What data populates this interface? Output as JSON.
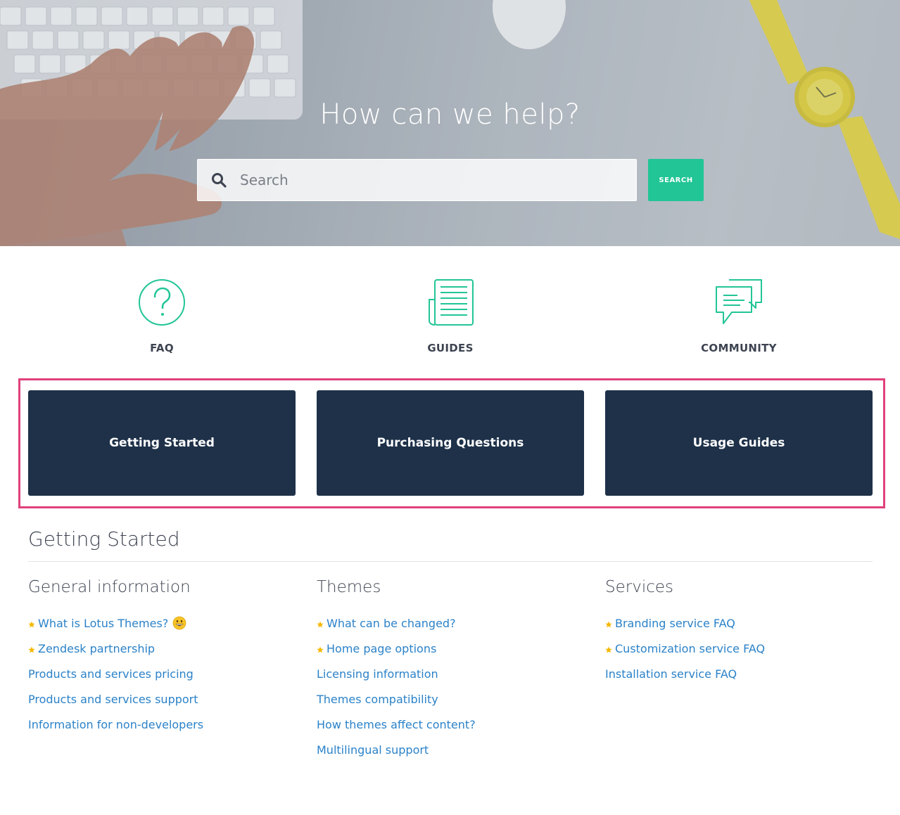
{
  "hero": {
    "title": "How can we help?",
    "search_placeholder": "Search",
    "search_button_label": "SEARCH"
  },
  "icon_nav": [
    {
      "label": "FAQ",
      "icon": "question-circle-icon"
    },
    {
      "label": "GUIDES",
      "icon": "document-icon"
    },
    {
      "label": "COMMUNITY",
      "icon": "chat-bubbles-icon"
    }
  ],
  "categories": [
    {
      "label": "Getting Started"
    },
    {
      "label": "Purchasing Questions"
    },
    {
      "label": "Usage Guides"
    }
  ],
  "section": {
    "title": "Getting Started",
    "columns": [
      {
        "title": "General information",
        "articles": [
          {
            "label": "What is Lotus Themes?",
            "starred": true,
            "emoji": "grinning-face"
          },
          {
            "label": "Zendesk partnership",
            "starred": true
          },
          {
            "label": "Products and services pricing",
            "starred": false
          },
          {
            "label": "Products and services support",
            "starred": false
          },
          {
            "label": "Information for non-developers",
            "starred": false
          }
        ]
      },
      {
        "title": "Themes",
        "articles": [
          {
            "label": "What can be changed?",
            "starred": true
          },
          {
            "label": "Home page options",
            "starred": true
          },
          {
            "label": "Licensing information",
            "starred": false
          },
          {
            "label": "Themes compatibility",
            "starred": false
          },
          {
            "label": "How themes affect content?",
            "starred": false
          },
          {
            "label": "Multilingual support",
            "starred": false
          }
        ]
      },
      {
        "title": "Services",
        "articles": [
          {
            "label": "Branding service FAQ",
            "starred": true
          },
          {
            "label": "Customization service FAQ",
            "starred": true
          },
          {
            "label": "Installation service FAQ",
            "starred": false
          }
        ]
      }
    ]
  },
  "colors": {
    "accent": "#22c596",
    "category_bg": "#1e3149",
    "link": "#2b82c8",
    "highlight": "#e0417a",
    "star": "#f5b800"
  }
}
